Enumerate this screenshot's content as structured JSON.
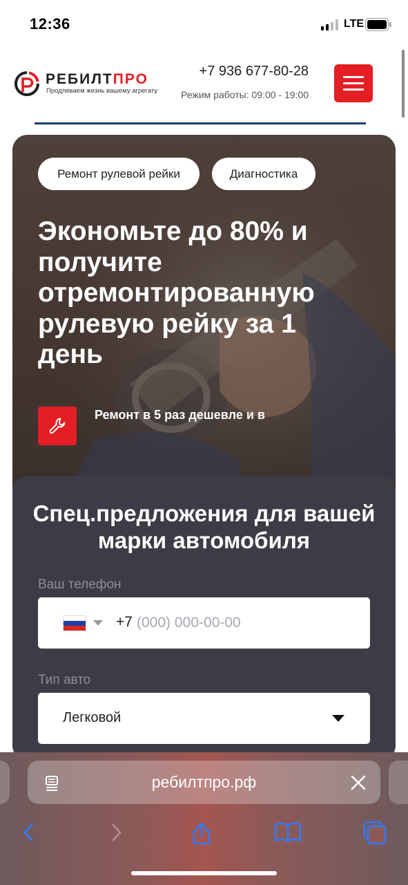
{
  "status_bar": {
    "time": "12:36",
    "network": "LTE"
  },
  "header": {
    "brand_main": "РЕБИЛТ",
    "brand_accent": "ПРО",
    "tagline": "Продлеваем жизнь вашему агрегату",
    "phone": "+7 936 677-80-28",
    "hours": "Режим работы: 09:00 - 19:00",
    "menu_icon": "hamburger-icon"
  },
  "hero": {
    "chips": [
      "Ремонт рулевой рейки",
      "Диагностика"
    ],
    "title": "Экономьте до 80% и получите отремонтированную рулевую рейку за 1 день",
    "feature_icon": "wrench-icon",
    "feature_text": "Ремонт в 5 раз дешевле и в"
  },
  "form": {
    "title": "Спец.предложения для вашей марки автомобиля",
    "phone_label": "Ваш телефон",
    "phone_prefix": "+7",
    "phone_placeholder": "(000) 000-00-00",
    "country_flag": "russia-flag",
    "car_type_label": "Тип авто",
    "car_type_value": "Легковой"
  },
  "browser": {
    "url": "ребилтпро.рф",
    "toolbar_icons": [
      "back-icon",
      "forward-icon",
      "share-icon",
      "bookmarks-icon",
      "tabs-icon"
    ]
  },
  "colors": {
    "accent_red": "#e31e24",
    "panel_dark": "#3c3c46",
    "ios_blue": "#3478f6"
  }
}
